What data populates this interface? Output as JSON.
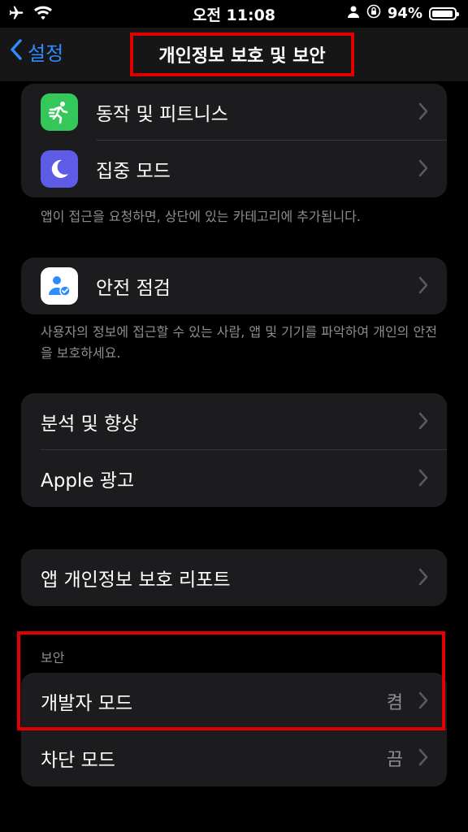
{
  "status_bar": {
    "time": "오전 11:08",
    "battery": "94%",
    "battery_level": 0.94,
    "icons": [
      "airplane-icon",
      "wifi-icon",
      "person-icon",
      "orientation-lock-icon",
      "battery-icon"
    ]
  },
  "nav": {
    "back_label": "설정",
    "title": "개인정보 보호 및 보안"
  },
  "group1": {
    "items": [
      {
        "label": "동작 및 피트니스",
        "icon": "fitness-running-icon",
        "color": "#34c759"
      },
      {
        "label": "집중 모드",
        "icon": "moon-icon",
        "color": "#5e5ce6"
      }
    ],
    "footer": "앱이 접근을 요청하면, 상단에 있는 카테고리에 추가됩니다."
  },
  "group2": {
    "items": [
      {
        "label": "안전 점검",
        "icon": "safety-check-icon",
        "color": "#ffffff"
      }
    ],
    "footer": "사용자의 정보에 접근할 수 있는 사람, 앱 및 기기를 파악하여 개인의 안전을 보호하세요."
  },
  "group3": {
    "items": [
      {
        "label": "분석 및 향상"
      },
      {
        "label": "Apple 광고"
      }
    ]
  },
  "group4": {
    "items": [
      {
        "label": "앱 개인정보 보호 리포트"
      }
    ]
  },
  "security": {
    "header": "보안",
    "items": [
      {
        "label": "개발자 모드",
        "value": "켬"
      },
      {
        "label": "차단 모드",
        "value": "끔"
      }
    ]
  },
  "colors": {
    "accent": "#2f8cff",
    "highlight": "#e00000",
    "cell": "#1c1c1e"
  }
}
